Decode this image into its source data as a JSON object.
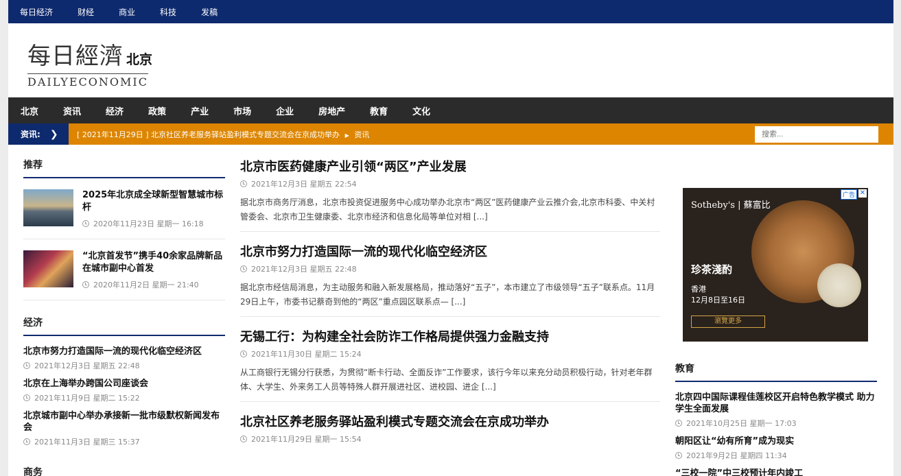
{
  "topbar": {
    "items": [
      "每日经济",
      "财经",
      "商业",
      "科技",
      "发稿"
    ]
  },
  "logo": {
    "cn": "每日經濟",
    "city": "北京",
    "en": "DAILYECONOMIC"
  },
  "mainnav": {
    "items": [
      "北京",
      "资讯",
      "经济",
      "政策",
      "产业",
      "市场",
      "企业",
      "房地产",
      "教育",
      "文化"
    ]
  },
  "ticker": {
    "label": "资讯:",
    "news": "[ 2021年11月29日 ] 北京社区养老服务驿站盈利模式专题交流会在京成功举办",
    "category": "资讯",
    "search_placeholder": "搜索..."
  },
  "left": {
    "section1": "推荐",
    "featured": [
      {
        "title": "2025年北京成全球新型智慧城市标杆",
        "meta": "2020年11月23日 星期一 16:18"
      },
      {
        "title": "“北京首发节”携手40余家品牌新品在城市副中心首发",
        "meta": "2020年11月2日 星期一 21:40"
      }
    ],
    "section2": "经济",
    "economy": [
      {
        "title": "北京市努力打造国际一流的现代化临空经济区",
        "meta": "2021年12月3日 星期五 22:48"
      },
      {
        "title": "北京在上海举办跨国公司座谈会",
        "meta": "2021年11月9日 星期二 15:22"
      },
      {
        "title": "北京城市副中心举办承接新一批市级默权新闻发布会",
        "meta": "2021年11月3日 星期三 15:37"
      }
    ],
    "section3": "商务"
  },
  "main": {
    "articles": [
      {
        "title": "北京市医药健康产业引领“两区”产业发展",
        "meta": "2021年12月3日 星期五 22:54",
        "excerpt": "据北京市商务厅消息，北京市投资促进服务中心成功举办北京市“两区”医药健康产业云推介会,北京市科委、中关村管委会、北京市卫生健康委、北京市经济和信息化局等单位对相 [...]"
      },
      {
        "title": "北京市努力打造国际一流的现代化临空经济区",
        "meta": "2021年12月3日 星期五 22:48",
        "excerpt": "据北京市经信局消息，为主动服务和融入新发展格局，推动落好“五子”，本市建立了市级领导“五子”联系点。11月29日上午，市委书记蔡奇到他的“两区”重点园区联系点— [...]"
      },
      {
        "title": "无锡工行：为构建全社会防诈工作格局提供强力金融支持",
        "meta": "2021年11月30日 星期二 15:24",
        "excerpt": "从工商银行无锡分行获悉，为贯彻“断卡行动、全面反诈”工作要求，该行今年以来充分动员积极行动，针对老年群体、大学生、外来务工人员等特殊人群开展进社区、进校园、进企 [...]"
      },
      {
        "title": "北京社区养老服务驿站盈利模式专题交流会在京成功举办",
        "meta": "2021年11月29日 星期一 15:54",
        "excerpt": ""
      }
    ]
  },
  "ad": {
    "brand": "Sotheby's | 蘇富比",
    "headline": "珍茶淺酌",
    "place": "香港",
    "dates": "12月8日至16日",
    "button": "瀏覽更多",
    "tag": "广告",
    "close": "✕"
  },
  "right": {
    "section": "教育",
    "items": [
      {
        "title": "北京四中国际课程佳莲校区开启特色教学模式 助力学生全面发展",
        "meta": "2021年10月25日 星期一 17:03"
      },
      {
        "title": "朝阳区让“幼有所育”成为现实",
        "meta": "2021年9月2日 星期四 11:34"
      },
      {
        "title": "“三校一院”中三校预计年内竣工",
        "meta": ""
      }
    ]
  }
}
